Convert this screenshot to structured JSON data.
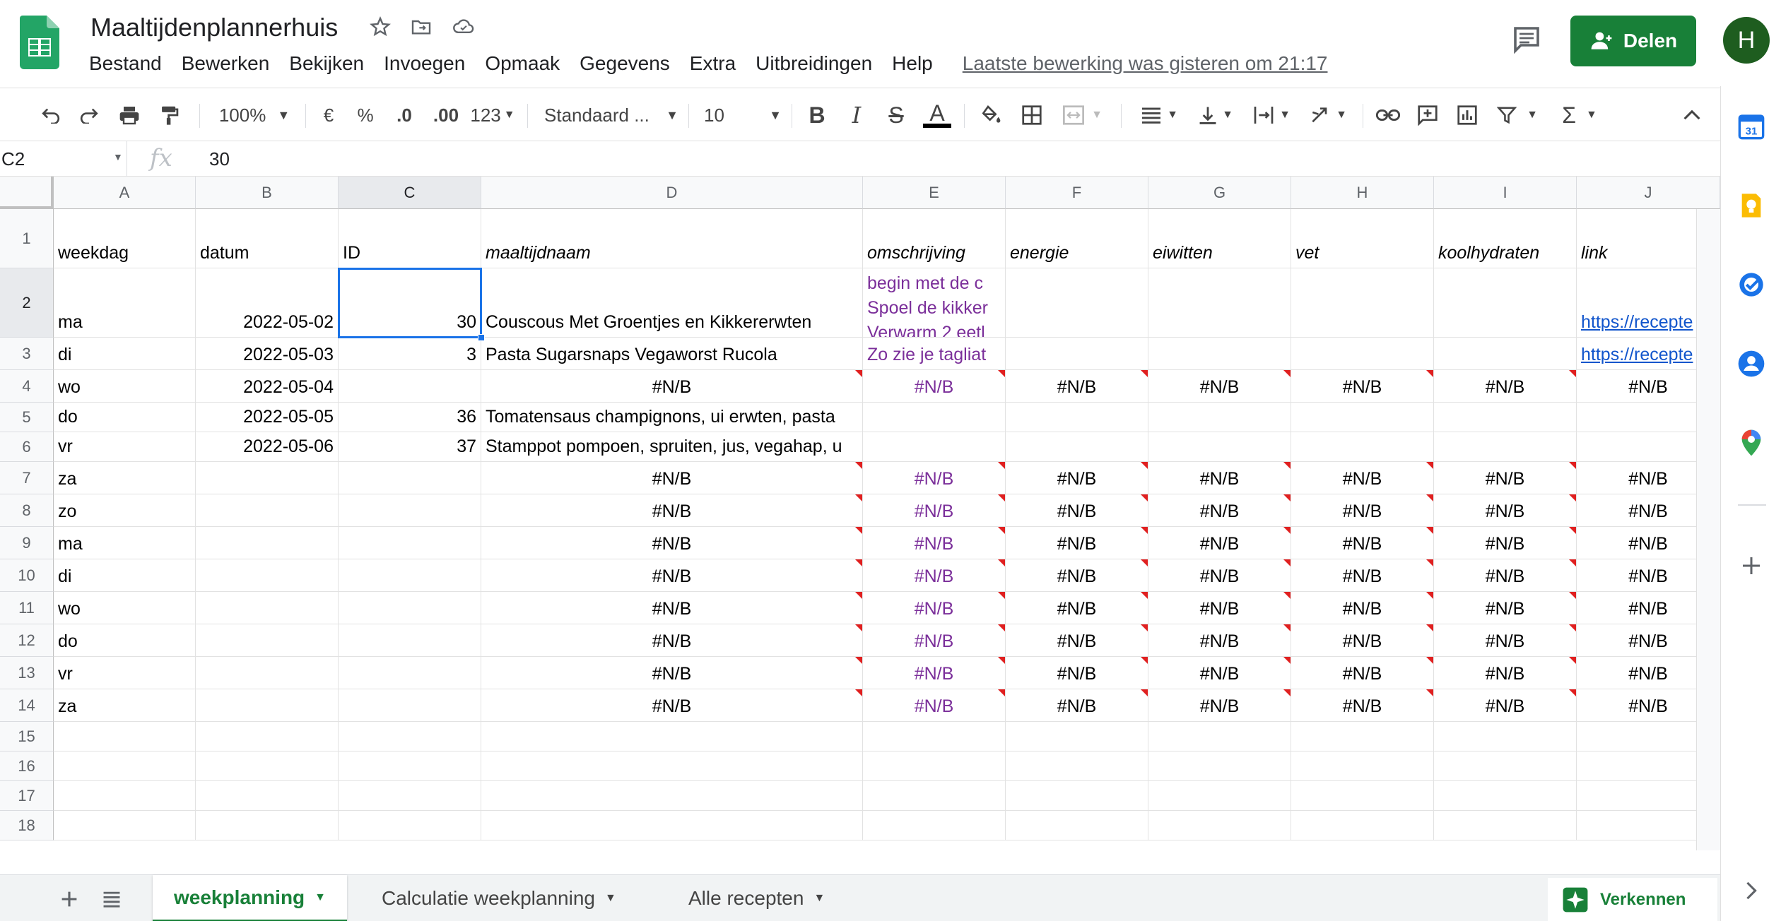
{
  "app": {
    "title": "Maaltijdenplannerhuis",
    "last_edit": "Laatste bewerking was gisteren om 21:17",
    "share_label": "Delen",
    "avatar_letter": "H"
  },
  "menu": [
    "Bestand",
    "Bewerken",
    "Bekijken",
    "Invoegen",
    "Opmaak",
    "Gegevens",
    "Extra",
    "Uitbreidingen",
    "Help"
  ],
  "toolbar": {
    "zoom": "100%",
    "currency": "€",
    "percent": "%",
    "dec_decrease": ".0",
    "dec_increase": ".00",
    "format_more": "123",
    "font": "Standaard ...",
    "font_size": "10",
    "bold": "B",
    "italic": "I",
    "strike": "S",
    "text_color_letter": "A"
  },
  "formula": {
    "cell_ref": "C2",
    "fx": "fx",
    "value": "30"
  },
  "columns": [
    "A",
    "B",
    "C",
    "D",
    "E",
    "F",
    "G",
    "H",
    "I",
    "J"
  ],
  "rows": [
    {
      "n": "1",
      "weekdag": "weekdag",
      "datum": "datum",
      "id": "ID",
      "maaltijdnaam": "maaltijdnaam",
      "omschrijving": "omschrijving",
      "energie": "energie",
      "eiwitten": "eiwitten",
      "vet": "vet",
      "koolhydraten": "koolhydraten",
      "link": "link"
    },
    {
      "n": "2",
      "weekdag": "ma",
      "datum": "2022-05-02",
      "id": "30",
      "maaltijdnaam": "Couscous Met Groentjes en Kikkererwten",
      "omschrijving": "begin met de c Spoel de kikker Verwarm 2 eetl",
      "energie": "",
      "eiwitten": "",
      "vet": "",
      "koolhydraten": "",
      "link": "https://recepte"
    },
    {
      "n": "3",
      "weekdag": "di",
      "datum": "2022-05-03",
      "id": "3",
      "maaltijdnaam": "Pasta Sugarsnaps Vegaworst Rucola",
      "omschrijving": "Zo zie je tagliat",
      "energie": "",
      "eiwitten": "",
      "vet": "",
      "koolhydraten": "",
      "link": "https://recepte"
    },
    {
      "n": "4",
      "weekdag": "wo",
      "datum": "2022-05-04",
      "id": "",
      "maaltijdnaam": "#N/B",
      "omschrijving": "#N/B",
      "energie": "#N/B",
      "eiwitten": "#N/B",
      "vet": "#N/B",
      "koolhydraten": "#N/B",
      "link": "#N/B"
    },
    {
      "n": "5",
      "weekdag": "do",
      "datum": "2022-05-05",
      "id": "36",
      "maaltijdnaam": "Tomatensaus champignons, ui erwten, pasta",
      "omschrijving": "",
      "energie": "",
      "eiwitten": "",
      "vet": "",
      "koolhydraten": "",
      "link": ""
    },
    {
      "n": "6",
      "weekdag": "vr",
      "datum": "2022-05-06",
      "id": "37",
      "maaltijdnaam": "Stamppot pompoen, spruiten, jus, vegahap, u",
      "omschrijving": "",
      "energie": "",
      "eiwitten": "",
      "vet": "",
      "koolhydraten": "",
      "link": ""
    },
    {
      "n": "7",
      "weekdag": "za",
      "datum": "",
      "id": "",
      "maaltijdnaam": "#N/B",
      "omschrijving": "#N/B",
      "energie": "#N/B",
      "eiwitten": "#N/B",
      "vet": "#N/B",
      "koolhydraten": "#N/B",
      "link": "#N/B"
    },
    {
      "n": "8",
      "weekdag": "zo",
      "datum": "",
      "id": "",
      "maaltijdnaam": "#N/B",
      "omschrijving": "#N/B",
      "energie": "#N/B",
      "eiwitten": "#N/B",
      "vet": "#N/B",
      "koolhydraten": "#N/B",
      "link": "#N/B"
    },
    {
      "n": "9",
      "weekdag": "ma",
      "datum": "",
      "id": "",
      "maaltijdnaam": "#N/B",
      "omschrijving": "#N/B",
      "energie": "#N/B",
      "eiwitten": "#N/B",
      "vet": "#N/B",
      "koolhydraten": "#N/B",
      "link": "#N/B"
    },
    {
      "n": "10",
      "weekdag": "di",
      "datum": "",
      "id": "",
      "maaltijdnaam": "#N/B",
      "omschrijving": "#N/B",
      "energie": "#N/B",
      "eiwitten": "#N/B",
      "vet": "#N/B",
      "koolhydraten": "#N/B",
      "link": "#N/B"
    },
    {
      "n": "11",
      "weekdag": "wo",
      "datum": "",
      "id": "",
      "maaltijdnaam": "#N/B",
      "omschrijving": "#N/B",
      "energie": "#N/B",
      "eiwitten": "#N/B",
      "vet": "#N/B",
      "koolhydraten": "#N/B",
      "link": "#N/B"
    },
    {
      "n": "12",
      "weekdag": "do",
      "datum": "",
      "id": "",
      "maaltijdnaam": "#N/B",
      "omschrijving": "#N/B",
      "energie": "#N/B",
      "eiwitten": "#N/B",
      "vet": "#N/B",
      "koolhydraten": "#N/B",
      "link": "#N/B"
    },
    {
      "n": "13",
      "weekdag": "vr",
      "datum": "",
      "id": "",
      "maaltijdnaam": "#N/B",
      "omschrijving": "#N/B",
      "energie": "#N/B",
      "eiwitten": "#N/B",
      "vet": "#N/B",
      "koolhydraten": "#N/B",
      "link": "#N/B"
    },
    {
      "n": "14",
      "weekdag": "za",
      "datum": "",
      "id": "",
      "maaltijdnaam": "#N/B",
      "omschrijving": "#N/B",
      "energie": "#N/B",
      "eiwitten": "#N/B",
      "vet": "#N/B",
      "koolhydraten": "#N/B",
      "link": "#N/B"
    },
    {
      "n": "15",
      "weekdag": "",
      "datum": "",
      "id": "",
      "maaltijdnaam": "",
      "omschrijving": "",
      "energie": "",
      "eiwitten": "",
      "vet": "",
      "koolhydraten": "",
      "link": ""
    },
    {
      "n": "16",
      "weekdag": "",
      "datum": "",
      "id": "",
      "maaltijdnaam": "",
      "omschrijving": "",
      "energie": "",
      "eiwitten": "",
      "vet": "",
      "koolhydraten": "",
      "link": ""
    },
    {
      "n": "17",
      "weekdag": "",
      "datum": "",
      "id": "",
      "maaltijdnaam": "",
      "omschrijving": "",
      "energie": "",
      "eiwitten": "",
      "vet": "",
      "koolhydraten": "",
      "link": ""
    },
    {
      "n": "18",
      "weekdag": "",
      "datum": "",
      "id": "",
      "maaltijdnaam": "",
      "omschrijving": "",
      "energie": "",
      "eiwitten": "",
      "vet": "",
      "koolhydraten": "",
      "link": ""
    }
  ],
  "sheets": [
    {
      "label": "weekplanning",
      "active": true
    },
    {
      "label": "Calculatie weekplanning",
      "active": false
    },
    {
      "label": "Alle recepten",
      "active": false
    }
  ],
  "explore_label": "Verkennen",
  "calendar_day": "31",
  "colors": {
    "accent": "#188038",
    "selection": "#1a73e8",
    "error_formula": "#7b2f9a",
    "link": "#1155cc"
  }
}
